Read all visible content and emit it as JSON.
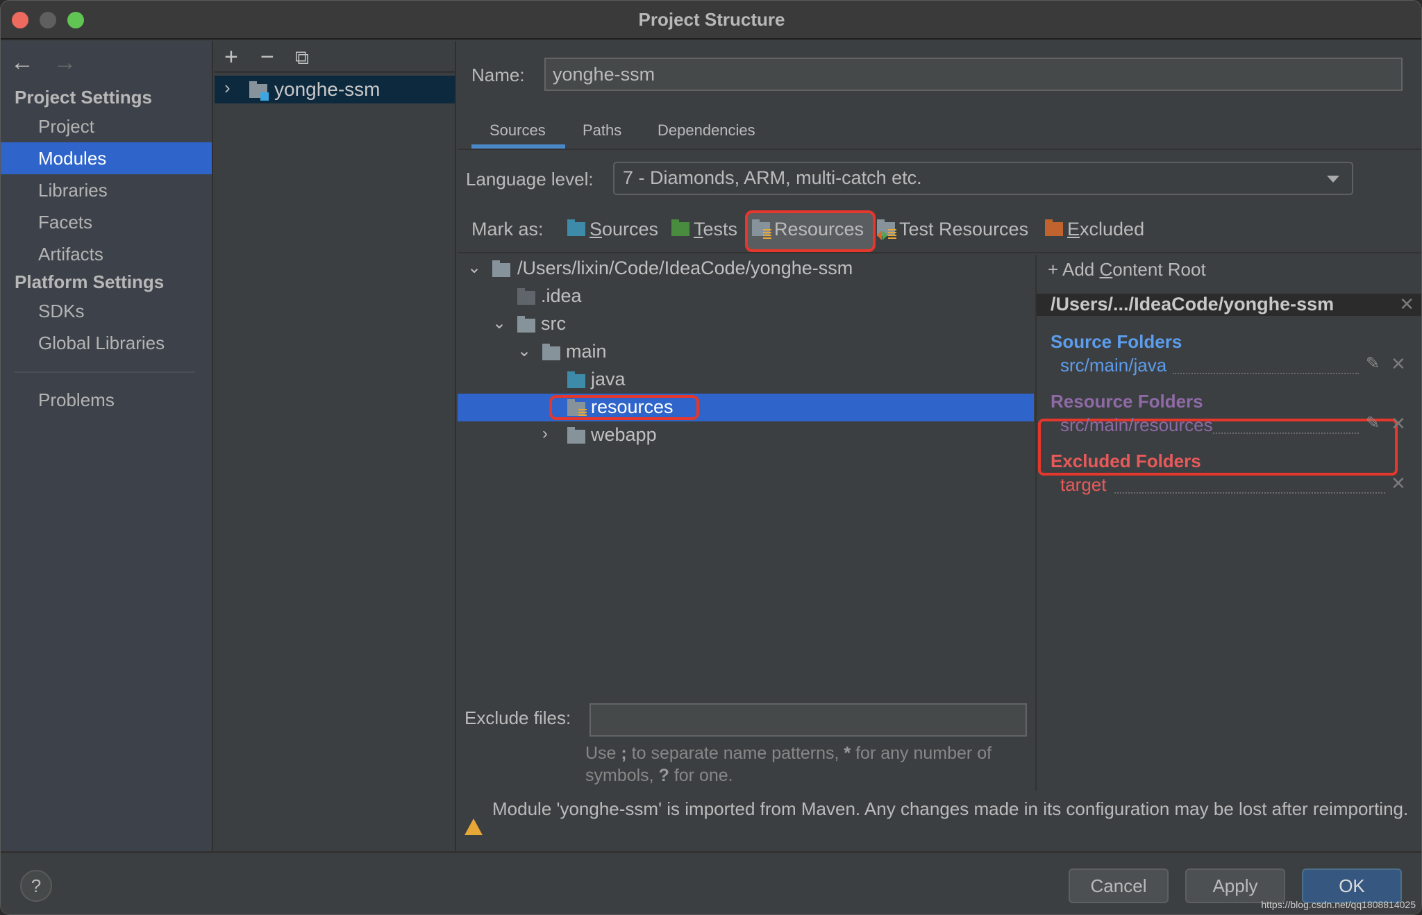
{
  "window": {
    "title": "Project Structure"
  },
  "sidebar": {
    "nav": {
      "back": "←",
      "forward": "→"
    },
    "project_settings_header": "Project Settings",
    "platform_settings_header": "Platform Settings",
    "items": [
      {
        "label": "Project"
      },
      {
        "label": "Modules",
        "selected": true
      },
      {
        "label": "Libraries"
      },
      {
        "label": "Facets"
      },
      {
        "label": "Artifacts"
      },
      {
        "label": "SDKs"
      },
      {
        "label": "Global Libraries"
      },
      {
        "label": "Problems"
      }
    ]
  },
  "modules": {
    "toolbar": {
      "add": "+",
      "remove": "−",
      "copy": "⧉"
    },
    "items": [
      {
        "label": "yonghe-ssm",
        "expand": "›"
      }
    ]
  },
  "main": {
    "name_label": "Name:",
    "name_value": "yonghe-ssm",
    "tabs": [
      {
        "label": "Sources",
        "active": true
      },
      {
        "label": "Paths"
      },
      {
        "label": "Dependencies"
      }
    ],
    "language_level_label": "Language level:",
    "language_level_value": "7 - Diamonds, ARM, multi-catch etc.",
    "mark_as": {
      "label": "Mark as:",
      "items": [
        {
          "label_first": "S",
          "label_rest": "ources",
          "color": "#3d8ba8"
        },
        {
          "label_first": "T",
          "label_rest": "ests",
          "color": "#4a8c3f"
        },
        {
          "label": "Resources",
          "color": "#87939a",
          "highlighted": true
        },
        {
          "label": "Test Resources",
          "color": "#87939a"
        },
        {
          "label_first": "E",
          "label_rest": "xcluded",
          "color": "#c0632e"
        }
      ]
    },
    "tree": [
      {
        "label": "/Users/lixin/Code/IdeaCode/yonghe-ssm",
        "chevron": "⌄",
        "color": "#87939a"
      },
      {
        "label": ".idea",
        "color": "#5f656b"
      },
      {
        "label": "src",
        "chevron": "⌄",
        "color": "#87939a"
      },
      {
        "label": "main",
        "chevron": "⌄",
        "color": "#87939a"
      },
      {
        "label": "java",
        "color": "#3d8ba8"
      },
      {
        "label": "resources",
        "color": "#87939a",
        "selected": true
      },
      {
        "label": "webapp",
        "chevron": "›",
        "color": "#87939a"
      }
    ],
    "content_roots": {
      "add_label_before": "Add ",
      "add_label_underlined": "C",
      "add_label_after": "ontent Root",
      "add_icon": "+",
      "root_path": "/Users/.../IdeaCode/yonghe-ssm",
      "close_icon": "✕",
      "edit_icon": "✎",
      "sections": [
        {
          "title": "Source Folders",
          "path": "src/main/java",
          "color": "#5c9ded",
          "editable": true
        },
        {
          "title": "Resource Folders",
          "path": "src/main/resources",
          "color": "#8e6aa6",
          "editable": true
        },
        {
          "title": "Excluded Folders",
          "path": "target",
          "color": "#e85a5a",
          "editable": false
        }
      ]
    },
    "exclude_files_label": "Exclude files:",
    "exclude_files_value": "",
    "hint_parts": [
      "Use ",
      ";",
      " to separate name patterns, ",
      "*",
      " for any number of symbols, ",
      "?",
      " for one."
    ],
    "warning": "Module 'yonghe-ssm' is imported from Maven. Any changes made in its configuration may be lost after reimporting."
  },
  "footer": {
    "help": "?",
    "cancel": "Cancel",
    "apply": "Apply",
    "ok": "OK",
    "watermark": "https://blog.csdn.net/qq1808814025"
  }
}
